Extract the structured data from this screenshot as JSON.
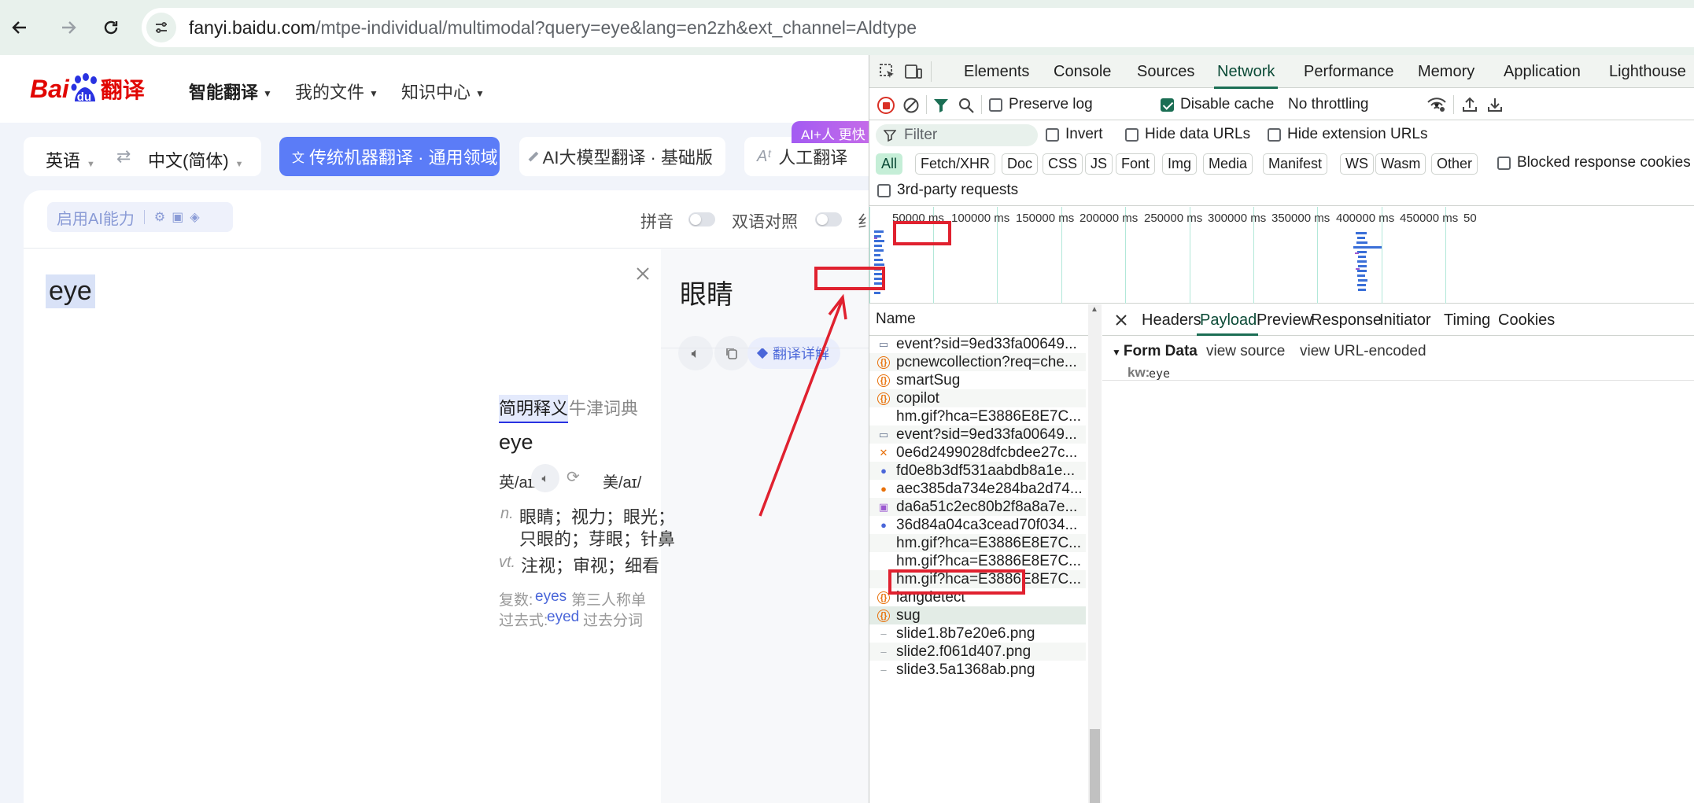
{
  "browser": {
    "url_domain": "fanyi.baidu.com",
    "url_rest": "/mtpe-individual/multimodal?query=eye&lang=en2zh&ext_channel=Aldtype"
  },
  "baidu": {
    "logo_bai": "Bai",
    "logo_du": "du",
    "logo_cn": "翻译",
    "nav": [
      "智能翻译",
      "我的文件",
      "知识中心"
    ],
    "source_lang": "英语",
    "target_lang": "中文(简体)",
    "modes": [
      "传统机器翻译 · 通用领域",
      "AI大模型翻译 · 基础版",
      "人工翻译"
    ],
    "ai_badge": "AI+人 更快",
    "ai_ability": "启用AI能力",
    "pinyin": "拼音",
    "bilingual": "双语对照",
    "cut_char": "纟",
    "input_text": "eye",
    "result": "眼睛",
    "detail_btn": "翻译详解",
    "dict_tabs": [
      "简明释义",
      "牛津词典"
    ],
    "headword": "eye",
    "uk": "英/aɪ/",
    "us": "美/aɪ/",
    "defs": [
      {
        "pos": "n.",
        "text": "眼睛；视力；眼光；",
        "text2": "只眼的；芽眼；针鼻"
      },
      {
        "pos": "vt.",
        "text": "注视；审视；细看"
      }
    ],
    "forms": [
      {
        "label": "复数:",
        "value": "eyes",
        "label2": "第三人称单"
      },
      {
        "label": "过去式:",
        "value": "eyed",
        "label2": "过去分词"
      }
    ]
  },
  "devtools": {
    "tabs": [
      "Elements",
      "Console",
      "Sources",
      "Network",
      "Performance",
      "Memory",
      "Application",
      "Lighthouse"
    ],
    "active_tab": "Network",
    "preserve_log": "Preserve log",
    "disable_cache": "Disable cache",
    "throttling": "No throttling",
    "filter_placeholder": "Filter",
    "invert": "Invert",
    "hide_data_urls": "Hide data URLs",
    "hide_ext_urls": "Hide extension URLs",
    "chips": [
      "All",
      "Fetch/XHR",
      "Doc",
      "CSS",
      "JS",
      "Font",
      "Img",
      "Media",
      "Manifest",
      "WS",
      "Wasm",
      "Other"
    ],
    "blocked_cookies": "Blocked response cookies",
    "third_party": "3rd-party requests",
    "ticks": [
      "50000 ms",
      "100000 ms",
      "150000 ms",
      "200000 ms",
      "250000 ms",
      "300000 ms",
      "350000 ms",
      "400000 ms",
      "450000 ms",
      "50"
    ],
    "name_header": "Name",
    "requests": [
      {
        "name": "event?sid=9ed33fa00649...",
        "icon": "img"
      },
      {
        "name": "pcnewcollection?req=che...",
        "icon": "xhr"
      },
      {
        "name": "smartSug",
        "icon": "xhr"
      },
      {
        "name": "copilot",
        "icon": "xhr"
      },
      {
        "name": "hm.gif?hca=E3886E8E7C...",
        "icon": "none"
      },
      {
        "name": "event?sid=9ed33fa00649...",
        "icon": "img"
      },
      {
        "name": "0e6d2499028dfcbdee27c...",
        "icon": "script"
      },
      {
        "name": "fd0e8b3df531aabdb8a1e...",
        "icon": "search"
      },
      {
        "name": "aec385da734e284ba2d74...",
        "icon": "circle"
      },
      {
        "name": "da6a51c2ec80b2f8a8a7e...",
        "icon": "pic"
      },
      {
        "name": "36d84a04ca3cead70f034...",
        "icon": "search"
      },
      {
        "name": "hm.gif?hca=E3886E8E7C...",
        "icon": "none"
      },
      {
        "name": "hm.gif?hca=E3886E8E7C...",
        "icon": "none"
      },
      {
        "name": "hm.gif?hca=E3886E8E7C...",
        "icon": "none"
      },
      {
        "name": "langdetect",
        "icon": "xhr"
      },
      {
        "name": "sug",
        "icon": "xhr"
      },
      {
        "name": "slide1.8b7e20e6.png",
        "icon": "dash"
      },
      {
        "name": "slide2.f061d407.png",
        "icon": "dash"
      },
      {
        "name": "slide3.5a1368ab.png",
        "icon": "dash"
      }
    ],
    "selected_request": "sug",
    "detail_tabs": [
      "Headers",
      "Payload",
      "Preview",
      "Response",
      "Initiator",
      "Timing",
      "Cookies"
    ],
    "active_detail_tab": "Payload",
    "form_data": "Form Data",
    "view_source": "view source",
    "view_url_encoded": "view URL-encoded",
    "param_key": "kw:",
    "param_value": "eye"
  },
  "colors": {
    "highlight_red": "#e0212f",
    "devtools_accent": "#1b6e54",
    "baidu_blue": "#2932e1",
    "baidu_red": "#e10602",
    "active_mode": "#5b7cf7"
  }
}
